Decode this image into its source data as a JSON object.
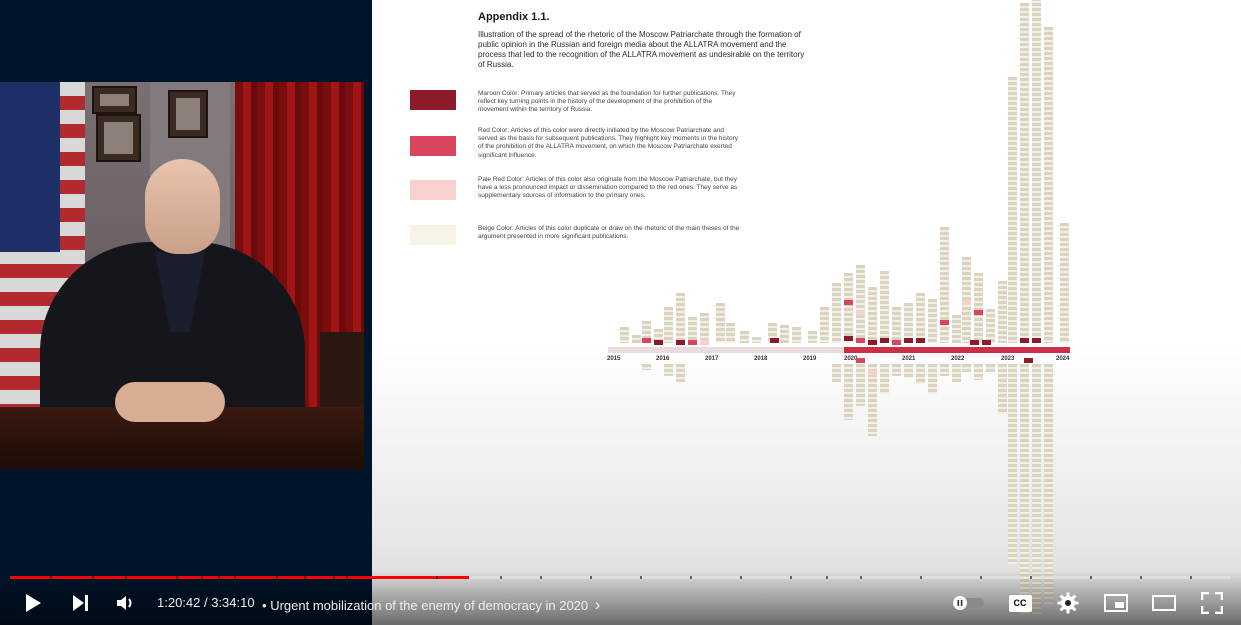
{
  "player": {
    "time_current": "1:20:42",
    "time_separator": " / ",
    "time_total": "3:34:10",
    "chapter_bullet": "•",
    "chapter_title": "Urgent mobilization of the enemy of democracy in 2020",
    "chapter_chevron": "›",
    "progress_played_fraction": 0.376,
    "accent_color": "#ff0000",
    "icons": {
      "play": "play-icon",
      "next": "next-icon",
      "volume": "volume-icon",
      "autoplay": "autoplay-toggle-icon",
      "captions": "cc-icon",
      "settings": "gear-icon",
      "miniplayer": "miniplayer-icon",
      "theater": "theater-icon",
      "fullscreen": "fullscreen-icon"
    },
    "captions_label": "CC"
  },
  "slide": {
    "title": "Appendix 1.1.",
    "subtitle": "Illustration of the spread of the rhetoric of the Moscow Patriarchate through the formation of public opinion in the Russian and foreign media about the ALLATRA movement and the process that led to the recognition of the ALLATRA movement as undesirable on the territory of Russia.",
    "legend": [
      {
        "color": "#8b1a2b",
        "text": "Maroon Color: Primary articles that served as the foundation for further publications. They reflect key turning points in the history of the development of the prohibition of the movement within the territory of Russia."
      },
      {
        "color": "#d9455d",
        "text": "Red Color: Articles of this color were directly initiated by the Moscow Patriarchate and served as the basis for subsequent publications. They highlight key moments in the history of the prohibition of the ALLATRA movement, on which the Moscow Patriarchate exerted significant influence."
      },
      {
        "color": "#f9d0d0",
        "text": "Pale Red Color: Articles of this color also originate from the Moscow Patriarchate, but they have a less pronounced impact or dissemination compared to the red ones. They serve as supplementary sources of information to the primary ones."
      },
      {
        "color": "#f7f4e6",
        "text": "Beige Color: Articles of this color duplicate or draw on the rhetoric of the main theses of the argument presented in more significant publications."
      }
    ],
    "years": [
      "2015",
      "2016",
      "2017",
      "2018",
      "2019",
      "2020",
      "2021",
      "2022",
      "2023",
      "2024"
    ]
  }
}
